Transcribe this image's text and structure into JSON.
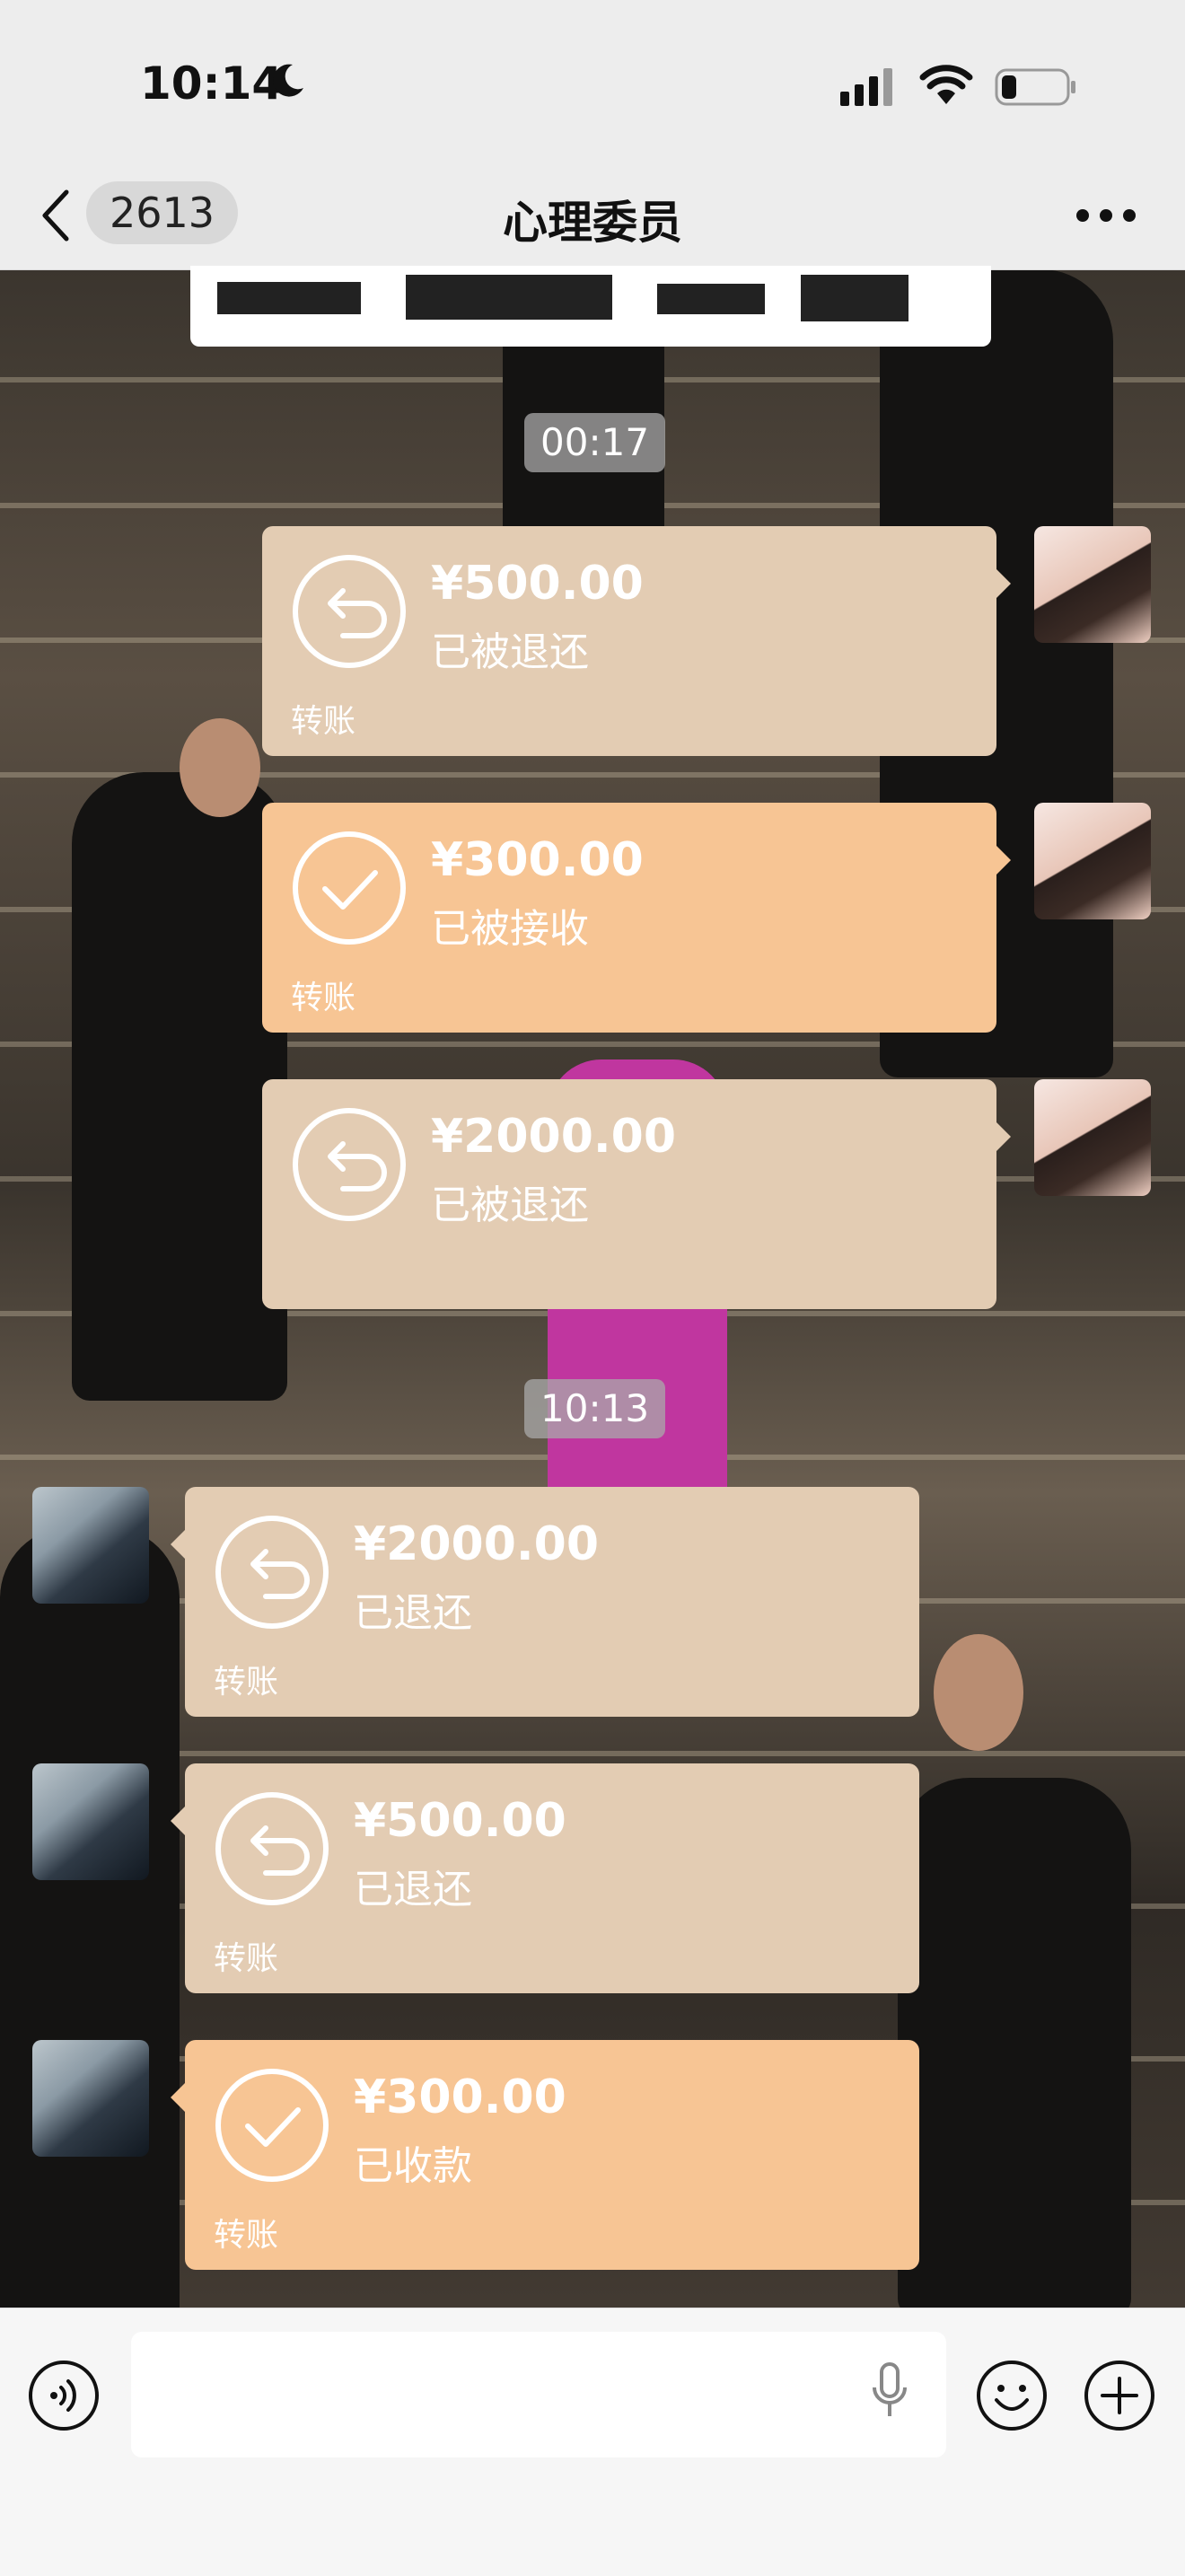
{
  "status_bar": {
    "time": "10:14"
  },
  "nav": {
    "unread_count": "2613",
    "title": "心理委员"
  },
  "timestamps": [
    "00:17",
    "10:13"
  ],
  "messages": [
    {
      "side": "right",
      "avatar": "girl",
      "kind": "refunded",
      "icon": "return-arrow-icon",
      "amount": "¥500.00",
      "status": "已被退还",
      "footer": "转账"
    },
    {
      "side": "right",
      "avatar": "girl",
      "kind": "accepted",
      "icon": "checkmark-icon",
      "amount": "¥300.00",
      "status": "已被接收",
      "footer": "转账"
    },
    {
      "side": "right",
      "avatar": "girl",
      "kind": "refunded",
      "icon": "return-arrow-icon",
      "amount": "¥2000.00",
      "status": "已被退还",
      "footer": ""
    },
    {
      "side": "left",
      "avatar": "boy",
      "kind": "refunded",
      "icon": "return-arrow-icon",
      "amount": "¥2000.00",
      "status": "已退还",
      "footer": "转账"
    },
    {
      "side": "left",
      "avatar": "boy",
      "kind": "refunded",
      "icon": "return-arrow-icon",
      "amount": "¥500.00",
      "status": "已退还",
      "footer": "转账"
    },
    {
      "side": "left",
      "avatar": "boy",
      "kind": "accepted",
      "icon": "checkmark-icon",
      "amount": "¥300.00",
      "status": "已收款",
      "footer": "转账"
    }
  ],
  "colors": {
    "refunded_bubble": "#e3ccb3",
    "accepted_bubble": "#f7c594",
    "nav_bg": "#ededed"
  },
  "input": {
    "value": ""
  }
}
